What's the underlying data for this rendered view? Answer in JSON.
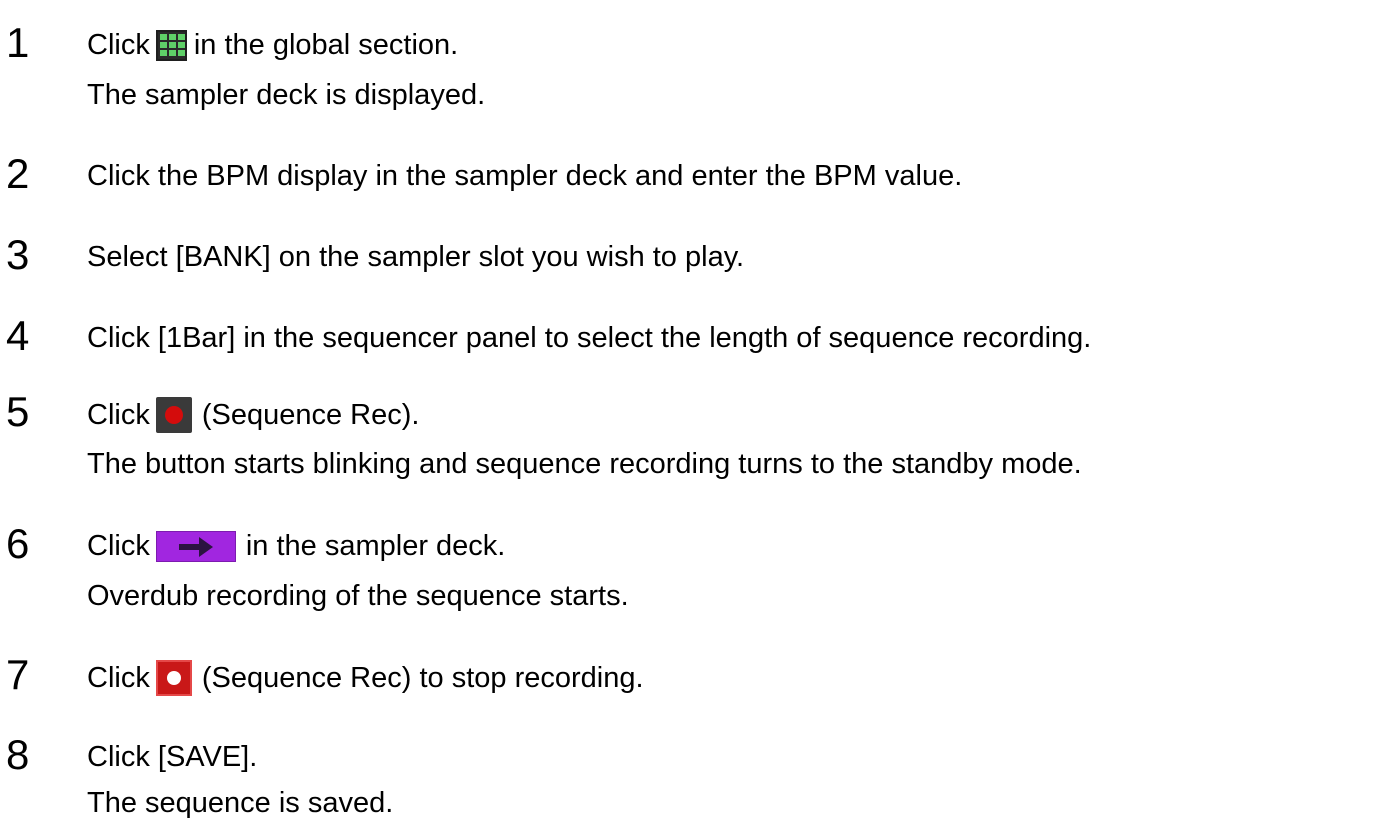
{
  "steps": [
    {
      "number": "1",
      "line1_before": "Click",
      "icon": "grid-icon",
      "line1_after": "in the global section.",
      "line2": "The sampler deck is displayed."
    },
    {
      "number": "2",
      "line1": "Click the BPM display in the sampler deck and enter the BPM value."
    },
    {
      "number": "3",
      "line1": "Select [BANK] on the sampler slot you wish to play."
    },
    {
      "number": "4",
      "line1": "Click [1Bar] in the sequencer panel to select the length of sequence recording."
    },
    {
      "number": "5",
      "line1_before": "Click",
      "icon": "sequence-rec-icon",
      "line1_after": "(Sequence Rec).",
      "line2": "The button starts blinking and sequence recording turns to the standby mode."
    },
    {
      "number": "6",
      "line1_before": "Click",
      "icon": "play-arrow-icon",
      "line1_after": "in the sampler deck.",
      "line2": "Overdub recording of the sequence starts."
    },
    {
      "number": "7",
      "line1_before": "Click",
      "icon": "sequence-rec-active-icon",
      "line1_after": "(Sequence Rec) to stop recording."
    },
    {
      "number": "8",
      "line1": "Click [SAVE].",
      "line2": "The sequence is saved."
    }
  ],
  "colors": {
    "text": "#000000",
    "grid_icon_bg": "#2a2a2a",
    "grid_icon_cells": "#5fd068",
    "rec_icon_bg": "#3a3a3a",
    "rec_dot": "#d40c0c",
    "arrow_icon_bg": "#a126e0",
    "rec_active_bg": "#c91818"
  }
}
